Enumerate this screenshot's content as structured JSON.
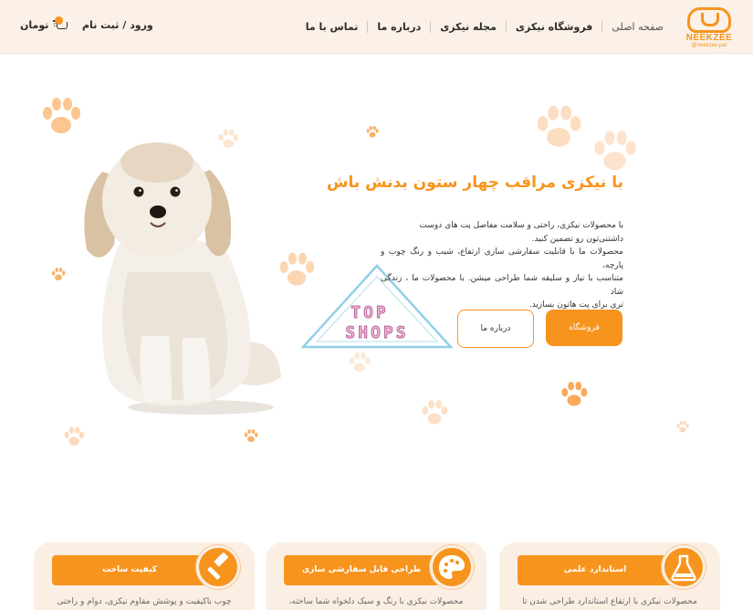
{
  "brand": {
    "name": "NEEKZEE",
    "domain": "@neekzee.pet",
    "accent": "#f7941d"
  },
  "nav": {
    "items": [
      "صفحه اصلی",
      "فروشگاه نیکزی",
      "مجله نیکزی",
      "درباره ما",
      "تماس با ما"
    ],
    "login_label": "ورود / ثبت نام",
    "currency_label": "تومان ◦"
  },
  "hero": {
    "title": "با نیکزی مراقب چهار ستون بدنش باش",
    "desc_lines": [
      "با محصولات نیکزی، راحتی و سلامت مفاصل پت های دوست",
      "داشتنی‌تون رو تضمین کنید.",
      "محصولات ما با قابلیت سفارشی سازی ارتفاع، شیب و رنگ چوب و پارچه،",
      "متناسب با نیاز و سلیقه شما طراحی میشن. با محصولات ما ، زندگی شاد",
      "تری برای پت هاتون بسازید."
    ],
    "shop_button": "فروشگاه",
    "about_button": "درباره ما"
  },
  "watermark": {
    "line1": "TOP",
    "line2": "SHOPS"
  },
  "cards": [
    {
      "title": "کیفیت ساخت",
      "text": "چوب باکیفیت و پوشش مقاوم نیکزی، دوام و راحتی",
      "icon": "hammer-icon"
    },
    {
      "title": "طراحی قابل سفارشی سازی",
      "text": "محصولات نیکزی با رنگ و سبک دلخواه شما ساخته،",
      "icon": "palette-icon"
    },
    {
      "title": "استاندارد علمی",
      "text": "محصولات نیکزی با ارتفاع استاندارد طراحی شدن تا",
      "icon": "flask-icon"
    }
  ]
}
